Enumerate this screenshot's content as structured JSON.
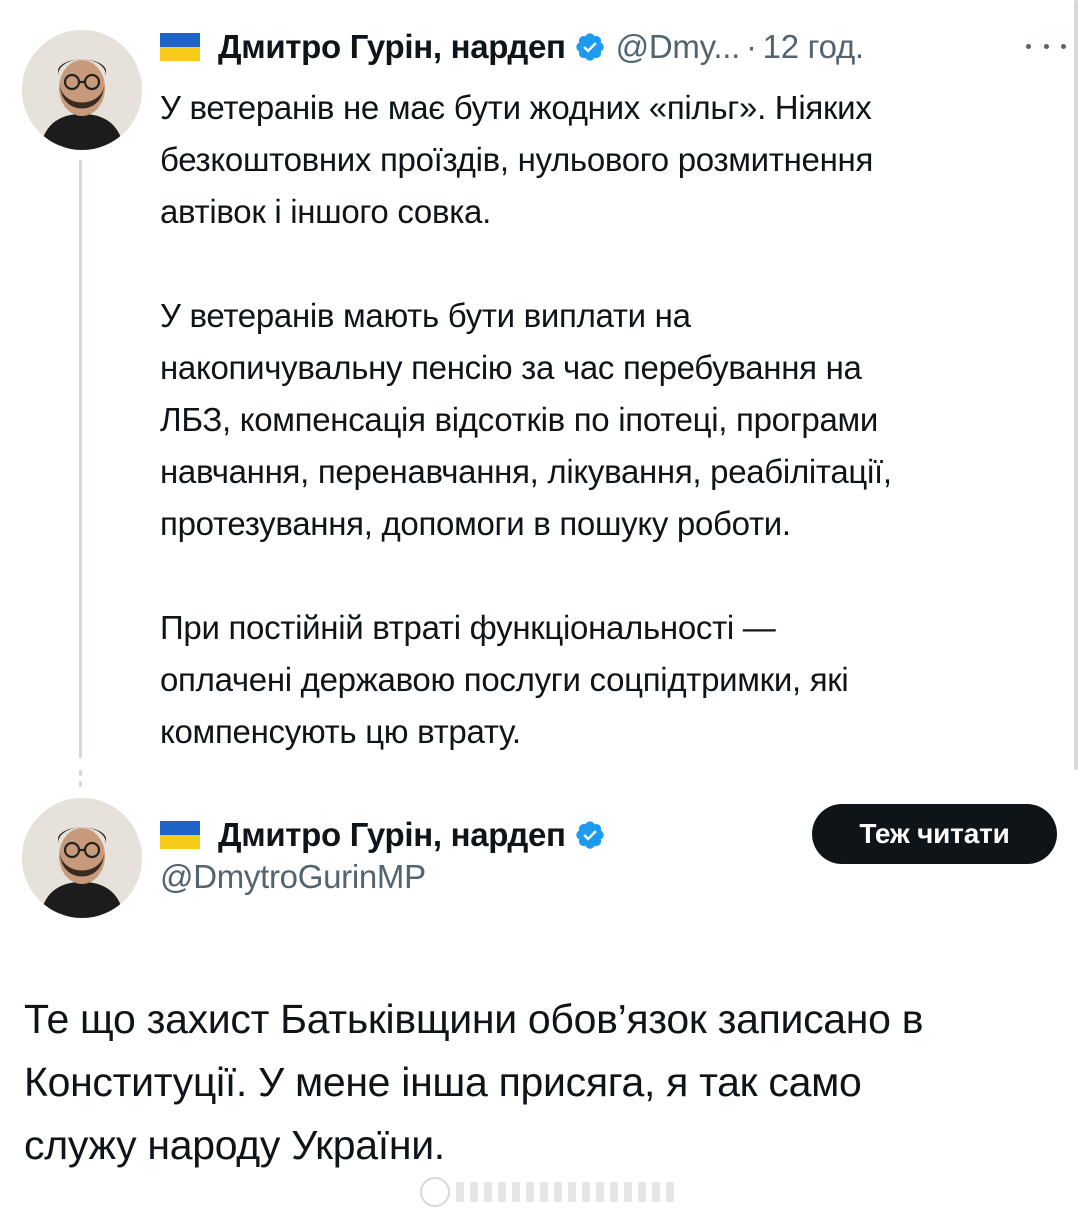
{
  "post": {
    "flag_icon": "ukraine-flag-icon",
    "author_name": "Дмитро Гурін, нардеп",
    "verified_icon": "verified-badge-icon",
    "handle": "@Dmy...",
    "separator": "·",
    "time": "12 год.",
    "more_icon": "more-options-icon",
    "paragraphs": [
      [
        "У ветеранів не має бути жодних «пільг». Ніяких",
        "безкоштовних проїздів, нульового розмитнення",
        "автівок і іншого совка."
      ],
      [
        "У ветеранів мають бути виплати на",
        "накопичувальну пенсію за час перебування на",
        "ЛБЗ, компенсація відсотків по іпотеці, програми",
        "навчання, перенавчання, лікування, реабілітації,",
        "протезування, допомоги в пошуку роботи."
      ],
      [
        "При постійній втраті функціональності —",
        "оплачені державою послуги соцпідтримки, які",
        "компенсують цю втрату."
      ]
    ]
  },
  "quoted": {
    "flag_icon": "ukraine-flag-icon",
    "author_name": "Дмитро Гурін, нардеп",
    "verified_icon": "verified-badge-icon",
    "handle": "@DmytroGurinMP",
    "follow_label": "Теж читати",
    "lines": [
      "Те що захист Батьківщини обов’язок записано в",
      "Конституції. У мене інша присяга, я так само",
      "служу народу України."
    ]
  },
  "colors": {
    "text": "#0f1419",
    "secondary": "#536471",
    "verified_blue": "#1d9bf0",
    "flag_blue": "#1d64c6",
    "flag_yellow": "#f6cc1b",
    "button_bg": "#0f1419"
  }
}
